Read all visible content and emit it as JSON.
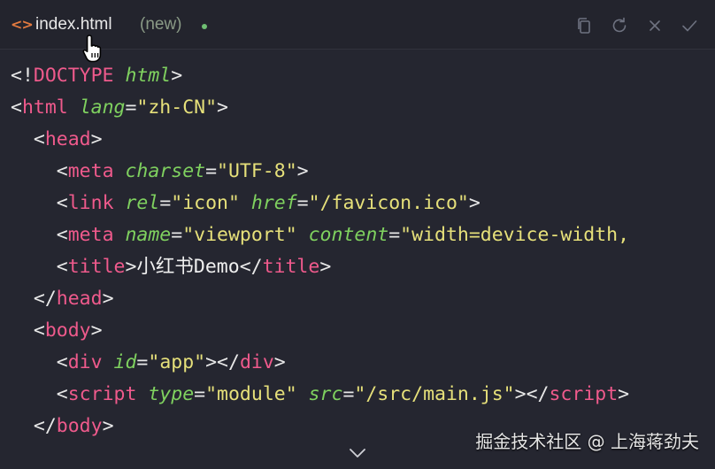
{
  "tab": {
    "icon": "code-brackets-icon",
    "filename": "index.html",
    "status": "(new)",
    "modified_dot_color": "#6fbf73"
  },
  "actions": [
    "copy-icon",
    "refresh-icon",
    "close-icon",
    "check-icon"
  ],
  "code": [
    {
      "indent": "",
      "tokens": [
        [
          "p",
          "<!"
        ],
        [
          "t",
          "DOCTYPE"
        ],
        [
          "p",
          " "
        ],
        [
          "a",
          "html"
        ],
        [
          "p",
          ">"
        ]
      ]
    },
    {
      "indent": "",
      "tokens": [
        [
          "p",
          "<"
        ],
        [
          "t",
          "html"
        ],
        [
          "p",
          " "
        ],
        [
          "a",
          "lang"
        ],
        [
          "p",
          "="
        ],
        [
          "s",
          "\"zh-CN\""
        ],
        [
          "p",
          ">"
        ]
      ]
    },
    {
      "indent": "  ",
      "tokens": [
        [
          "p",
          "<"
        ],
        [
          "t",
          "head"
        ],
        [
          "p",
          ">"
        ]
      ]
    },
    {
      "indent": "    ",
      "tokens": [
        [
          "p",
          "<"
        ],
        [
          "t",
          "meta"
        ],
        [
          "p",
          " "
        ],
        [
          "a",
          "charset"
        ],
        [
          "p",
          "="
        ],
        [
          "s",
          "\"UTF-8\""
        ],
        [
          "p",
          ">"
        ]
      ]
    },
    {
      "indent": "    ",
      "tokens": [
        [
          "p",
          "<"
        ],
        [
          "t",
          "link"
        ],
        [
          "p",
          " "
        ],
        [
          "a",
          "rel"
        ],
        [
          "p",
          "="
        ],
        [
          "s",
          "\"icon\""
        ],
        [
          "p",
          " "
        ],
        [
          "a",
          "href"
        ],
        [
          "p",
          "="
        ],
        [
          "s",
          "\"/favicon.ico\""
        ],
        [
          "p",
          ">"
        ]
      ]
    },
    {
      "indent": "    ",
      "tokens": [
        [
          "p",
          "<"
        ],
        [
          "t",
          "meta"
        ],
        [
          "p",
          " "
        ],
        [
          "a",
          "name"
        ],
        [
          "p",
          "="
        ],
        [
          "s",
          "\"viewport\""
        ],
        [
          "p",
          " "
        ],
        [
          "a",
          "content"
        ],
        [
          "p",
          "="
        ],
        [
          "s",
          "\"width=device-width,"
        ]
      ]
    },
    {
      "indent": "    ",
      "tokens": [
        [
          "p",
          "<"
        ],
        [
          "t",
          "title"
        ],
        [
          "p",
          ">"
        ],
        [
          "x",
          "小红书Demo"
        ],
        [
          "p",
          "</"
        ],
        [
          "t",
          "title"
        ],
        [
          "p",
          ">"
        ]
      ]
    },
    {
      "indent": "  ",
      "tokens": [
        [
          "p",
          "</"
        ],
        [
          "t",
          "head"
        ],
        [
          "p",
          ">"
        ]
      ]
    },
    {
      "indent": "  ",
      "tokens": [
        [
          "p",
          "<"
        ],
        [
          "t",
          "body"
        ],
        [
          "p",
          ">"
        ]
      ]
    },
    {
      "indent": "    ",
      "tokens": [
        [
          "p",
          "<"
        ],
        [
          "t",
          "div"
        ],
        [
          "p",
          " "
        ],
        [
          "a",
          "id"
        ],
        [
          "p",
          "="
        ],
        [
          "s",
          "\"app\""
        ],
        [
          "p",
          "></"
        ],
        [
          "t",
          "div"
        ],
        [
          "p",
          ">"
        ]
      ]
    },
    {
      "indent": "    ",
      "tokens": [
        [
          "p",
          "<"
        ],
        [
          "t",
          "script"
        ],
        [
          "p",
          " "
        ],
        [
          "a",
          "type"
        ],
        [
          "p",
          "="
        ],
        [
          "s",
          "\"module\""
        ],
        [
          "p",
          " "
        ],
        [
          "a",
          "src"
        ],
        [
          "p",
          "="
        ],
        [
          "s",
          "\"/src/main.js\""
        ],
        [
          "p",
          "></"
        ],
        [
          "t",
          "script"
        ],
        [
          "p",
          ">"
        ]
      ]
    },
    {
      "indent": "  ",
      "tokens": [
        [
          "p",
          "</"
        ],
        [
          "t",
          "body"
        ],
        [
          "p",
          ">"
        ]
      ]
    }
  ],
  "watermark": "掘金技术社区 @ 上海蒋劲夫"
}
